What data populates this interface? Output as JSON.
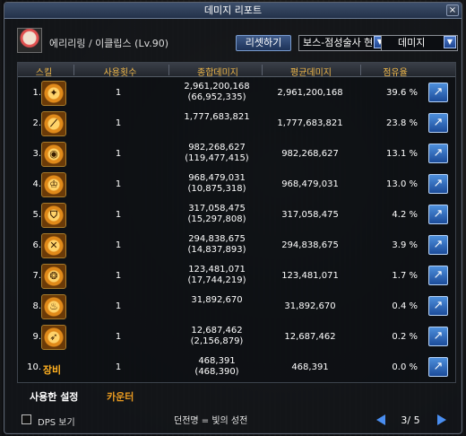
{
  "window": {
    "title": "데미지 리포트",
    "close": "×"
  },
  "character": {
    "name": "에리리링 / 이클립스 (Lv.90)",
    "reset_label": "리셋하기",
    "dungeon": "보스-점성술사 현",
    "metric": "데미지"
  },
  "columns": {
    "skill": "스킬",
    "uses": "사용횟수",
    "total": "종합데미지",
    "avg": "평균데미지",
    "share": "점유율"
  },
  "rows": [
    {
      "rank": "1.",
      "uses": "1",
      "total": "2,961,200,168",
      "total_sub": "(66,952,335)",
      "avg": "2,961,200,168",
      "share": "39.6 %"
    },
    {
      "rank": "2.",
      "uses": "1",
      "total": "1,777,683,821",
      "total_sub": "",
      "avg": "1,777,683,821",
      "share": "23.8 %"
    },
    {
      "rank": "3.",
      "uses": "1",
      "total": "982,268,627",
      "total_sub": "(119,477,415)",
      "avg": "982,268,627",
      "share": "13.1 %"
    },
    {
      "rank": "4.",
      "uses": "1",
      "total": "968,479,031",
      "total_sub": "(10,875,318)",
      "avg": "968,479,031",
      "share": "13.0 %"
    },
    {
      "rank": "5.",
      "uses": "1",
      "total": "317,058,475",
      "total_sub": "(15,297,808)",
      "avg": "317,058,475",
      "share": "4.2 %"
    },
    {
      "rank": "6.",
      "uses": "1",
      "total": "294,838,675",
      "total_sub": "(14,837,893)",
      "avg": "294,838,675",
      "share": "3.9 %"
    },
    {
      "rank": "7.",
      "uses": "1",
      "total": "123,481,071",
      "total_sub": "(17,744,219)",
      "avg": "123,481,071",
      "share": "1.7 %"
    },
    {
      "rank": "8.",
      "uses": "1",
      "total": "31,892,670",
      "total_sub": "",
      "avg": "31,892,670",
      "share": "0.4 %"
    },
    {
      "rank": "9.",
      "uses": "1",
      "total": "12,687,462",
      "total_sub": "(2,156,879)",
      "avg": "12,687,462",
      "share": "0.2 %"
    },
    {
      "rank": "10.",
      "skill_text": "장비",
      "uses": "1",
      "total": "468,391",
      "total_sub": "(468,390)",
      "avg": "468,391",
      "share": "0.0 %"
    }
  ],
  "tabs": {
    "used": "사용한 설정",
    "counter": "카운터"
  },
  "footer": {
    "dps_label": "DPS 보기",
    "status": "던전명 = 빛의 성전",
    "page": "3/ 5"
  },
  "colors": {
    "header_text": "#f0b84a",
    "accent_blue": "#4a8ef0",
    "orange_tab": "#e89a20"
  }
}
